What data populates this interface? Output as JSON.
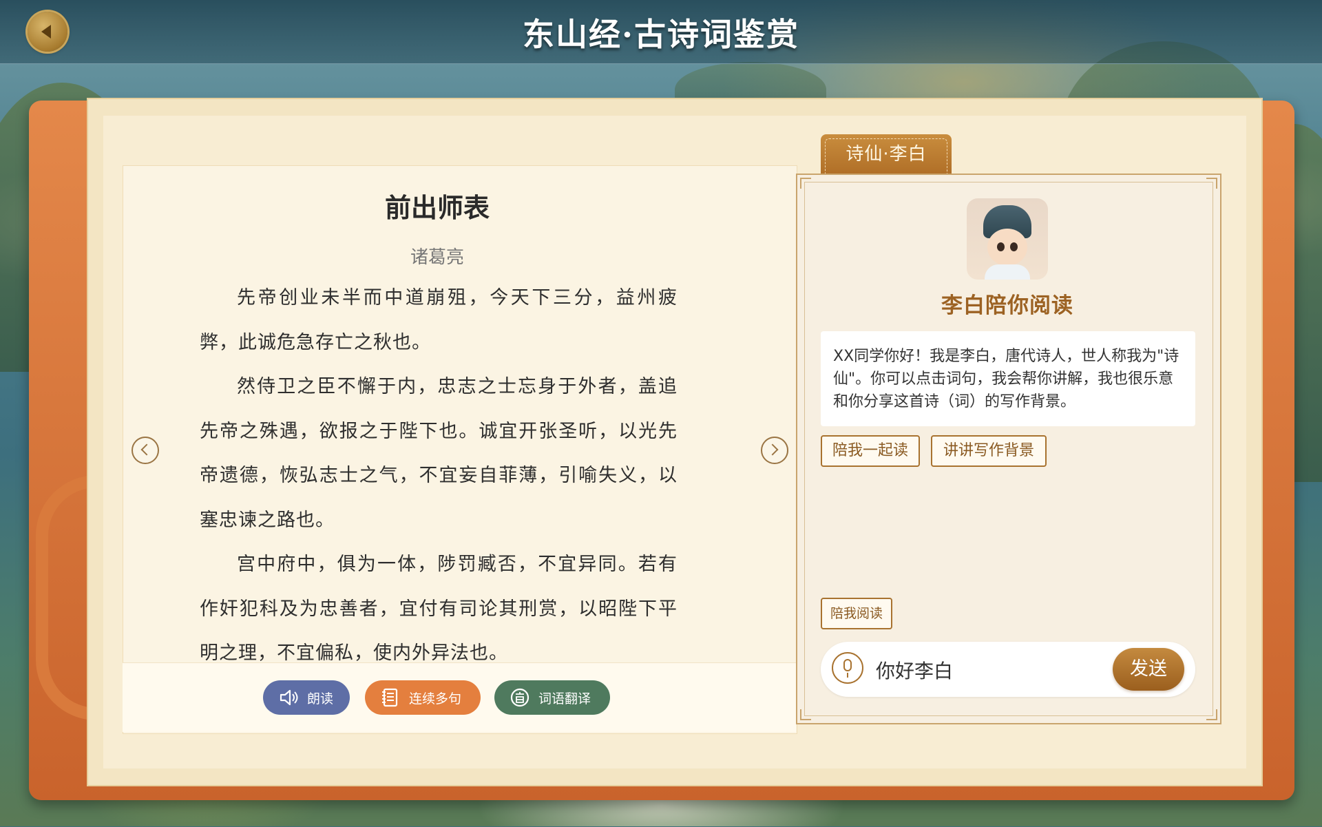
{
  "header": {
    "app_title": "东山经·古诗词鉴赏"
  },
  "poem": {
    "title": "前出师表",
    "author": "诸葛亮",
    "paragraphs": [
      "先帝创业未半而中道崩殂，今天下三分，益州疲弊，此诚危急存亡之秋也。",
      "然侍卫之臣不懈于内，忠志之士忘身于外者，盖追先帝之殊遇，欲报之于陛下也。诚宜开张圣听，以光先帝遗德，恢弘志士之气，不宜妄自菲薄，引喻失义，以塞忠谏之路也。",
      "宫中府中，俱为一体，陟罚臧否，不宜异同。若有作奸犯科及为忠善者，宜付有司论其刑赏，以昭陛下平明之理，不宜偏私，使内外异法也。"
    ]
  },
  "toolbar": {
    "read_aloud": "朗读",
    "multi_sentence": "连续多句",
    "translate": "词语翻译"
  },
  "companion": {
    "tab_label": "诗仙·李白",
    "name_title": "李白陪你阅读",
    "greeting": "XX同学你好！我是李白，唐代诗人，世人称我为\"诗仙\"。你可以点击词句，我会帮你讲解，我也很乐意和你分享这首诗（词）的写作背景。",
    "suggestions": [
      "陪我一起读",
      "讲讲写作背景"
    ],
    "quick_action": "陪我阅读",
    "input_value": "你好李白",
    "send_label": "发送"
  },
  "icons": {
    "back": "arrow-left-icon",
    "prev": "chevron-left-icon",
    "next": "chevron-right-icon",
    "speaker": "speaker-icon",
    "list": "list-icon",
    "translate": "translate-icon",
    "mic": "microphone-icon"
  },
  "colors": {
    "read_button": "#5e6ea6",
    "multi_button": "#e47f3e",
    "translate_button": "#4f7a5e",
    "accent_brown": "#9c6223"
  }
}
